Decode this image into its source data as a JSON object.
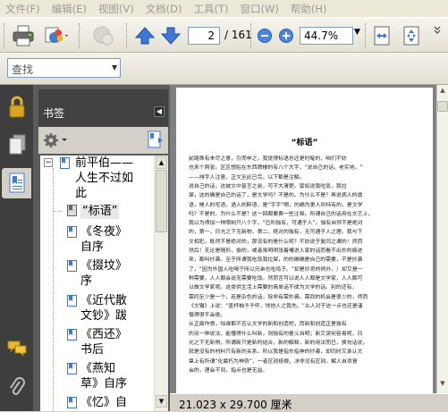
{
  "menu": [
    "文件(F)",
    "编辑(E)",
    "视图(V)",
    "文档(D)",
    "工具(T)",
    "窗口(W)",
    "帮助(H)"
  ],
  "toolbar": {
    "current_page": "2",
    "total_pages": "/ 161",
    "zoom": "44.7%"
  },
  "find": {
    "placeholder": "查找"
  },
  "bookmarks": {
    "title": "书签",
    "items": [
      {
        "label_lines": [
          "前平伯——",
          "人生不过如",
          "此"
        ]
      },
      {
        "label_lines": [
          "“标语”"
        ]
      },
      {
        "label_lines": [
          "《冬夜》",
          "自序"
        ]
      },
      {
        "label_lines": [
          "《掇坟》",
          "序"
        ]
      },
      {
        "label_lines": [
          "《近代散",
          "文钞》跋"
        ]
      },
      {
        "label_lines": [
          "《西还》",
          "书后"
        ]
      },
      {
        "label_lines": [
          "《燕知",
          "草》自序"
        ]
      },
      {
        "label_lines": [
          "《忆》自"
        ]
      }
    ]
  },
  "document": {
    "title": "“标语”",
    "lines": [
      "前路殊有未尽之意，引而申之，我觉得标语总还是时髦的，咱们不妨",
      "也来个两张。区区想贴在东西牌楼的有八个大字，“说自己的话，老实地。”",
      "——排字人注意，正文至此已完，以下都是注解。",
      "说自己的话，这被文中普言之矣，可不大清楚。譬如说我吃饭，我拉",
      "屎，这的确是自己的话了，是文学吗？不是的。为什么不是？再说病人的谵",
      "语，睡人的呓语，酒人的醉语，是“字字”啊，的确为更人所特有的，是文学",
      "吗？不是的。为什么不是？这一回都要费一些注释。所谓自己的话用在文艺上，",
      "我以为得加一种限制只八个字，“已所独有，可通于人”。独有自然不是绝对",
      "的，第一，日光之下无新物，第二，绝对的独有，无可通于人之理。我与下",
      "文相犯，既然不是绝对的，那没有的是什么呢？不妨说于复同之谓的！然而",
      "然后！无论是随形，偷的，或者虽明明张着嘴说人家的话而看不出抄的痕迹",
      "来，都叫抄袭。至于所谓我吃饭我拉屎，的的确确是自己的需要，不是抄袭",
      "了，“因为外国人吃喝子所以兄弟也吃鸡子。”却是珍奇的例外。）却又是一",
      "种需要。人人都会说无需要吃饭。然而言可以说人人都是文学家，人人都可",
      "以做文学家呢。这类供生活上需要的简单话不成为文学的话。别的还有，",
      "需同至少是一个，若是杂色的话，除非有需抄袭。需同的机会是很少的，然而",
      "《文辙》上说：“盖杼柚予予怀，怵他人之我先。”古人对于这一点也还是谨",
      "慎得很不会绝。",
      "从正面作想，怕谁都不否认文学的新和创造吧，而新和创造正是独有",
      "的另一种说法。能懂得什么叫新，则独有的意义自明；新又误何容易呢，日",
      "光之下无新物，所谓新只是新的结合，新的解释，新的用法而已，换句话说，",
      "就是没有的材料只有新的关系。所以我是指东指神的抄袭，却同时又承认文",
      "章上有所谓“化腐朽为神奇”，一者区别极微，决非没有区别。解人自须意",
      "会的，理会不到，指点也是无益。"
    ],
    "page_size": "21.023 x 29.700 厘米"
  }
}
